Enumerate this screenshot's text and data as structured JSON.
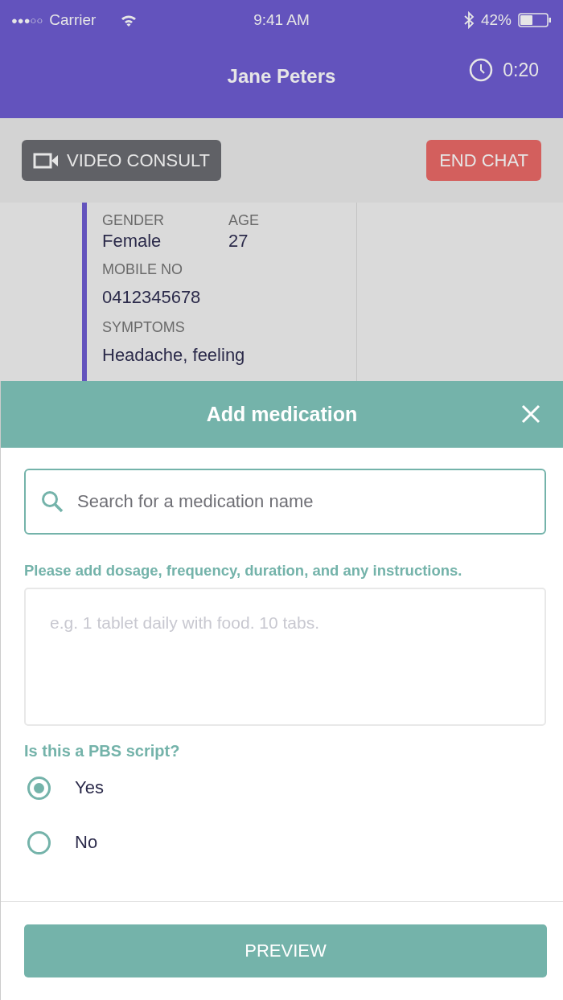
{
  "status_bar": {
    "signal": "●●●○○",
    "carrier": "Carrier",
    "time": "9:41 AM",
    "battery": "42%"
  },
  "header": {
    "title": "Jane Peters",
    "timer": "0:20"
  },
  "actions": [
    {
      "label": "VIDEO CONSULT",
      "kind": "video"
    },
    {
      "label": "END CHAT",
      "kind": "end"
    }
  ],
  "patient": {
    "fields": [
      {
        "label": "GENDER",
        "value": "Female"
      },
      {
        "label": "AGE",
        "value": "27"
      },
      {
        "label": "MOBILE NO",
        "value": "0412345678"
      },
      {
        "label": "SYMPTOMS",
        "value": "Headache, feeling"
      }
    ]
  },
  "sheet": {
    "title": "Add medication",
    "search": {
      "placeholder": "Search for a medication name"
    },
    "instructions_label": "Please add dosage, frequency, duration, and any instructions.",
    "instructions": {
      "placeholder": "e.g. 1 tablet daily with food. 10 tabs."
    },
    "question": "Is this a PBS script?",
    "options": [
      {
        "label": "Yes",
        "selected": true
      },
      {
        "label": "No",
        "selected": false
      }
    ],
    "button": "PREVIEW"
  }
}
